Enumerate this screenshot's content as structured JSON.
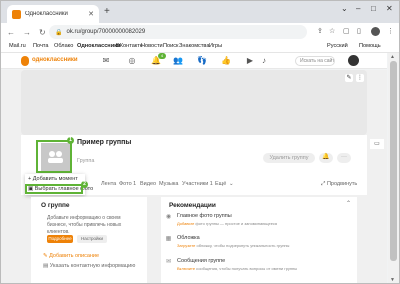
{
  "browser": {
    "tab_title": "Одноклассники",
    "tab_close": "✕",
    "new_tab": "+",
    "url": "ok.ru/group/70000000082029",
    "win_controls": [
      "⌄",
      "–",
      "□",
      "✕"
    ]
  },
  "bookmarks": [
    "Mail.ru",
    "Почта",
    "Облако",
    "Одноклассники",
    "ВКонтакте",
    "Новости",
    "Поиск",
    "Знакомства",
    "Игры",
    "Русский",
    "Помощь"
  ],
  "ok_header": {
    "logo_text": "одноклассники",
    "notifications_badge": "4",
    "search_placeholder": "Искать на сайте"
  },
  "group": {
    "name": "Пример группы",
    "type": "Группа",
    "join_button": "Удалить группу",
    "more": "···",
    "tabs": [
      "Лента",
      "Фото 1",
      "Видео",
      "Музыка",
      "Участники 1",
      "Ещё"
    ],
    "promote": "Продвинуть"
  },
  "avatar_menu": {
    "items": [
      "Добавить момент",
      "Выбрать главное фото"
    ]
  },
  "annotations": [
    "1",
    "2"
  ],
  "left_card": {
    "title": "О группе",
    "text": "Добавьте информацию о своем бизнесе, чтобы привлечь новых клиентов.",
    "btn_primary": "Подробнее",
    "btn_secondary": "Настройки",
    "links": [
      "Добавить описание",
      "Указать контактную информацию"
    ]
  },
  "right_card": {
    "title": "Рекомендации",
    "items": [
      {
        "title": "Главное фото группы",
        "desc_hl": "Добавьте",
        "desc": " фото группы — простое и запоминающееся"
      },
      {
        "title": "Обложка",
        "desc_hl": "Загрузите",
        "desc": " обложку, чтобы подчеркнуть уникальность группы"
      },
      {
        "title": "Сообщения группе",
        "desc_hl": "Включите",
        "desc": " сообщения, чтобы получать вопросы от имени группы"
      }
    ]
  },
  "colors": {
    "accent": "#ee8208",
    "annotation": "#5fb336"
  }
}
